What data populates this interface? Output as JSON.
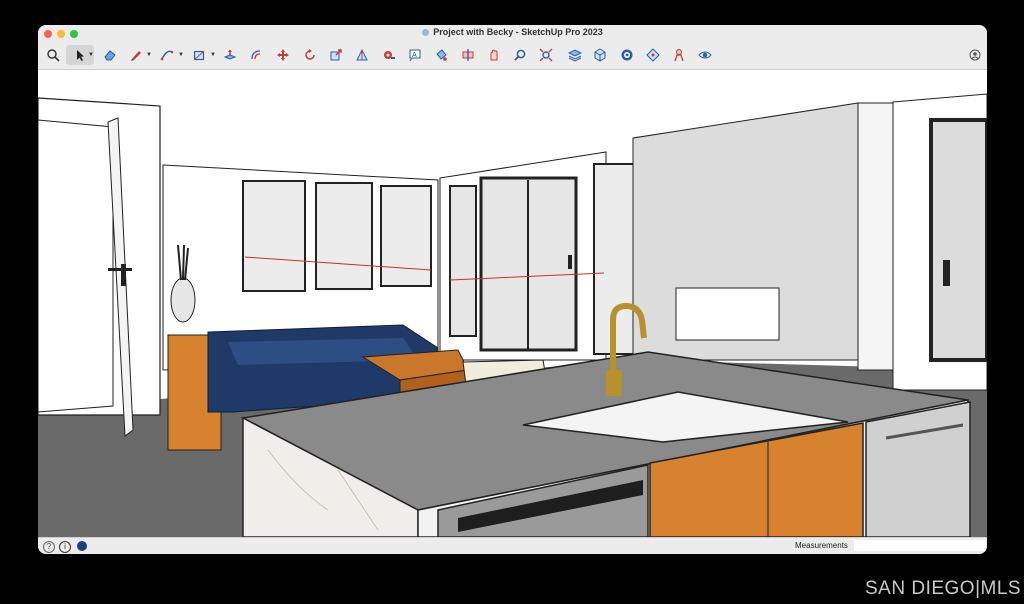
{
  "window": {
    "title": "Project with Becky - SketchUp Pro 2023"
  },
  "toolbar": {
    "tools": [
      {
        "name": "search",
        "icon": "search-icon",
        "glyph": "🔍"
      },
      {
        "name": "select",
        "icon": "select-arrow-icon",
        "glyph": "➤"
      },
      {
        "name": "eraser",
        "icon": "eraser-icon",
        "glyph": "◈"
      },
      {
        "name": "line",
        "icon": "pencil-icon",
        "glyph": "✎"
      },
      {
        "name": "arc",
        "icon": "arc-icon",
        "glyph": "◠"
      },
      {
        "name": "shapes",
        "icon": "rectangle-icon",
        "glyph": "▱"
      },
      {
        "name": "push-pull",
        "icon": "push-pull-icon",
        "glyph": "⬒"
      },
      {
        "name": "offset",
        "icon": "offset-icon",
        "glyph": "↻"
      },
      {
        "name": "move",
        "icon": "move-icon",
        "glyph": "✥"
      },
      {
        "name": "rotate",
        "icon": "rotate-icon",
        "glyph": "⟳"
      },
      {
        "name": "scale",
        "icon": "scale-icon",
        "glyph": "⬚"
      },
      {
        "name": "follow-me",
        "icon": "follow-me-icon",
        "glyph": "◭"
      },
      {
        "name": "tape-measure",
        "icon": "tape-measure-icon",
        "glyph": "◉"
      },
      {
        "name": "text",
        "icon": "text-icon",
        "glyph": "A"
      },
      {
        "name": "paint-bucket",
        "icon": "paint-bucket-icon",
        "glyph": "♨"
      },
      {
        "name": "section-plane",
        "icon": "section-plane-icon",
        "glyph": "⊕"
      },
      {
        "name": "orbit",
        "icon": "orbit-icon",
        "glyph": "✋"
      },
      {
        "name": "zoom",
        "icon": "zoom-icon",
        "glyph": "⚲"
      },
      {
        "name": "zoom-extents",
        "icon": "zoom-extents-icon",
        "glyph": "✕"
      },
      {
        "name": "layers",
        "icon": "layers-icon",
        "glyph": "≋"
      },
      {
        "name": "components",
        "icon": "components-icon",
        "glyph": "⬡"
      },
      {
        "name": "materials",
        "icon": "materials-icon",
        "glyph": "❂"
      },
      {
        "name": "warehouse",
        "icon": "warehouse-icon",
        "glyph": "❖"
      },
      {
        "name": "extension",
        "icon": "extension-icon",
        "glyph": "♙"
      },
      {
        "name": "view",
        "icon": "eye-icon",
        "glyph": "◕"
      }
    ],
    "account_icon": "account-icon"
  },
  "colors": {
    "background": "#000000",
    "window": "#ececec",
    "accent": "#2a6fd6"
  },
  "statusbar": {
    "measurements_label": "Measurements",
    "measurements_value": ""
  },
  "watermark": {
    "text": "SAN DIEGO|MLS"
  }
}
